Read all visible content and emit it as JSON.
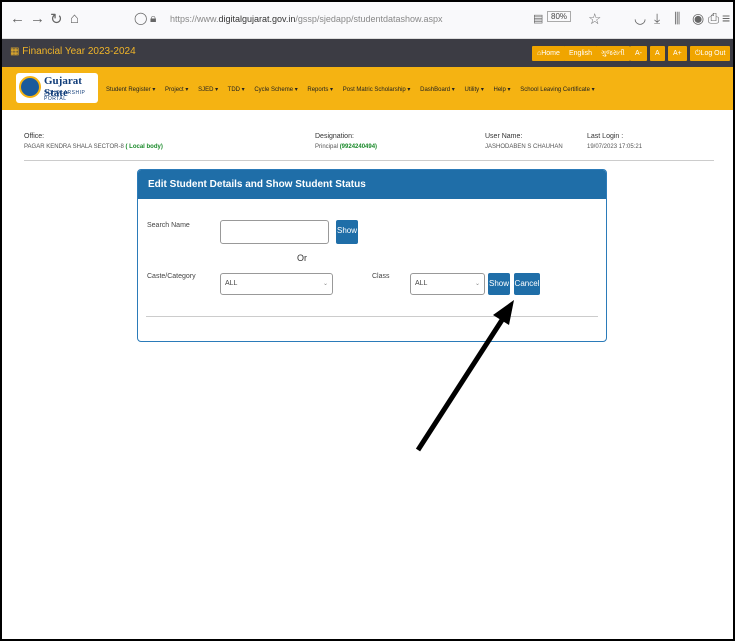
{
  "browser": {
    "url_prefix": "https://www.",
    "url_domain": "digitalgujarat.gov.in",
    "url_path": "/gssp/sjedapp/studentdatashow.aspx",
    "zoom": "80%"
  },
  "header": {
    "financial_year_label": "Financial Year",
    "financial_year": "2023-2024",
    "buttons": [
      "Home",
      "English",
      "ગુજરાતી",
      "A-",
      "A",
      "A+",
      "Log Out"
    ]
  },
  "logo": {
    "title": "Gujarat State",
    "subtitle": "SCHOLARSHIP PORTAL"
  },
  "menu": [
    "Student Register ▾",
    "Project ▾",
    "SJED ▾",
    "TDD ▾",
    "Cycle Scheme ▾",
    "Reports ▾",
    "Post Matric Scholarship ▾",
    "DashBoard ▾",
    "Utility ▾",
    "Help ▾",
    "School Leaving Certificate ▾"
  ],
  "user": {
    "office_label": "Office:",
    "office_value": "PAGAR KENDRA SHALA SECTOR-8",
    "office_type": "( Local body)",
    "designation_label": "Designation:",
    "designation_value": "Principal",
    "designation_phone": "(9924240494)",
    "username_label": "User Name:",
    "username_value": "JASHODABEN S CHAUHAN",
    "lastlogin_label": "Last Login :",
    "lastlogin_value": "19/07/2023 17:05:21"
  },
  "panel": {
    "title": "Edit Student Details and Show Student Status",
    "search_label": "Search Name",
    "search_value": "",
    "show_label": "Show",
    "or_label": "Or",
    "caste_label": "Caste/Category",
    "caste_value": "ALL",
    "class_label": "Class",
    "class_value": "ALL",
    "show2_label": "Show",
    "cancel_label": "Cancel"
  },
  "colors": {
    "accent": "#1f6ea8",
    "menubar": "#f5b312",
    "darkbar": "#3c3c44"
  }
}
